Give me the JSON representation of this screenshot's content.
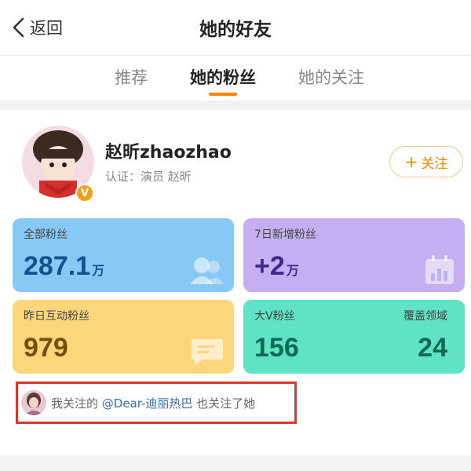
{
  "header": {
    "back_label": "返回",
    "title": "她的好友"
  },
  "tabs": [
    {
      "label": "推荐",
      "active": false
    },
    {
      "label": "她的粉丝",
      "active": true
    },
    {
      "label": "她的关注",
      "active": false
    }
  ],
  "user": {
    "name": "赵昕zhaozhao",
    "verify": "认证：演员 赵昕",
    "badge": "V",
    "follow_label": "关注"
  },
  "stats": {
    "all_fans": {
      "label": "全部粉丝",
      "value": "287.1",
      "unit": "万"
    },
    "new_fans_7d": {
      "label": "7日新增粉丝",
      "value": "+2",
      "unit": "万"
    },
    "interact_yesterday": {
      "label": "昨日互动粉丝",
      "value": "979"
    },
    "big_v": {
      "label": "大V粉丝",
      "value": "156",
      "right_label": "覆盖领域",
      "right_value": "24"
    }
  },
  "mutual": {
    "prefix": "我关注的",
    "link": "@Dear-迪丽热巴",
    "suffix": "也关注了她"
  },
  "colors": {
    "accent": "#ff8200",
    "highlight_box": "#e0352a",
    "blue_card": "#88c8f5",
    "purple_card": "#c3aff2",
    "yellow_card": "#fbd67b",
    "green_card": "#5fe3c4"
  }
}
